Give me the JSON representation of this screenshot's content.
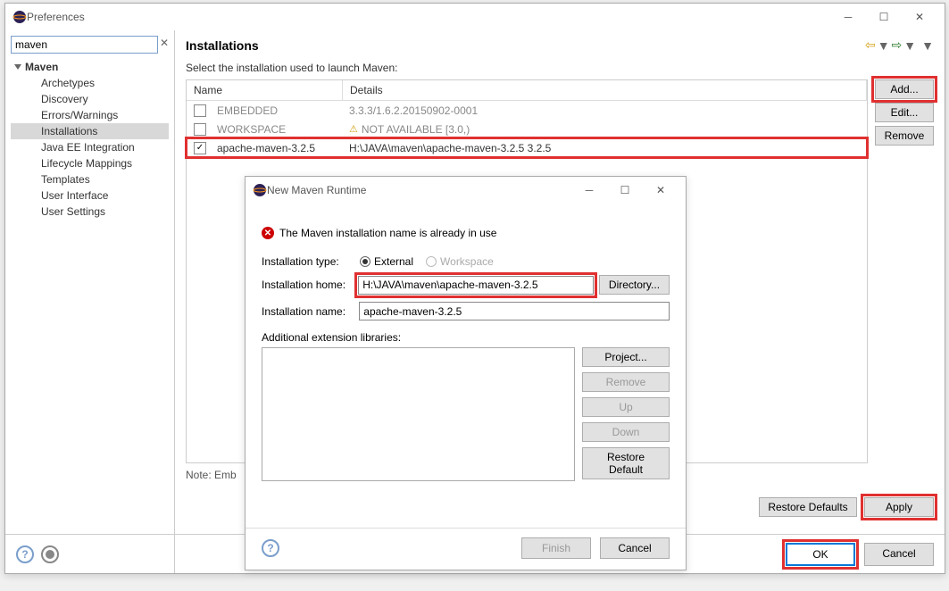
{
  "window": {
    "title": "Preferences"
  },
  "search": {
    "value": "maven"
  },
  "tree": {
    "root": "Maven",
    "items": [
      "Archetypes",
      "Discovery",
      "Errors/Warnings",
      "Installations",
      "Java EE Integration",
      "Lifecycle Mappings",
      "Templates",
      "User Interface",
      "User Settings"
    ],
    "selected": "Installations"
  },
  "page": {
    "heading": "Installations",
    "subhead": "Select the installation used to launch Maven:",
    "columns": {
      "name": "Name",
      "details": "Details"
    },
    "rows": [
      {
        "checked": false,
        "name": "EMBEDDED",
        "details": "3.3.3/1.6.2.20150902-0001",
        "warn": false
      },
      {
        "checked": false,
        "name": "WORKSPACE",
        "details": "NOT AVAILABLE [3.0,)",
        "warn": true
      },
      {
        "checked": true,
        "name": "apache-maven-3.2.5",
        "details": "H:\\JAVA\\maven\\apache-maven-3.2.5 3.2.5",
        "warn": false
      }
    ],
    "buttons": {
      "add": "Add...",
      "edit": "Edit...",
      "remove": "Remove"
    },
    "note": "Note: Emb",
    "restore": "Restore Defaults",
    "apply": "Apply"
  },
  "footer": {
    "ok": "OK",
    "cancel": "Cancel"
  },
  "dialog": {
    "title": "New Maven Runtime",
    "error": "The Maven installation name is already in use",
    "labels": {
      "type": "Installation type:",
      "home": "Installation home:",
      "name": "Installation name:",
      "libs": "Additional extension libraries:"
    },
    "radios": {
      "external": "External",
      "workspace": "Workspace"
    },
    "home_value": "H:\\JAVA\\maven\\apache-maven-3.2.5",
    "name_value": "apache-maven-3.2.5",
    "buttons": {
      "directory": "Directory...",
      "project": "Project...",
      "remove": "Remove",
      "up": "Up",
      "down": "Down",
      "restore": "Restore Default",
      "finish": "Finish",
      "cancel": "Cancel"
    }
  }
}
